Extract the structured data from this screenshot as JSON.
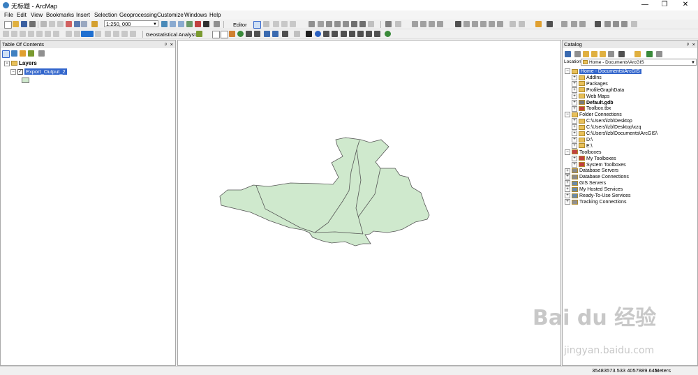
{
  "window": {
    "title": "无标题 - ArcMap",
    "minimize": "—",
    "maximize": "❐",
    "close": "✕"
  },
  "menu": [
    "File",
    "Edit",
    "View",
    "Bookmarks",
    "Insert",
    "Selection",
    "Geoprocessing",
    "Customize",
    "Windows",
    "Help"
  ],
  "toolbar": {
    "scale": "1:250, 000",
    "editor_label": "Editor",
    "geostat_label": "Geostatistical Analyst"
  },
  "toc": {
    "title": "Table Of Contents",
    "root": "Layers",
    "layer": "Export_Output_2"
  },
  "catalog": {
    "title": "Catalog",
    "location_label": "Location:",
    "location_value": "Home - Documents\\ArcGIS",
    "items": [
      {
        "label": "Home - Documents\\ArcGIS",
        "level": 0,
        "icon": "folder-icon",
        "selected": true
      },
      {
        "label": "AddIns",
        "level": 1,
        "icon": "folder-icon"
      },
      {
        "label": "Packages",
        "level": 1,
        "icon": "folder-icon"
      },
      {
        "label": "ProfileGraphData",
        "level": 1,
        "icon": "folder-icon"
      },
      {
        "label": "Web Maps",
        "level": 1,
        "icon": "folder-icon"
      },
      {
        "label": "Default.gdb",
        "level": 1,
        "icon": "geodatabase-icon",
        "bold": true
      },
      {
        "label": "Toolbox.tbx",
        "level": 1,
        "icon": "toolbox-icon"
      },
      {
        "label": "Folder Connections",
        "level": 0,
        "icon": "folder-connections-icon"
      },
      {
        "label": "C:\\Users\\lzb\\Desktop",
        "level": 1,
        "icon": "folder-icon"
      },
      {
        "label": "C:\\Users\\lzb\\Desktop\\xzq",
        "level": 1,
        "icon": "folder-icon"
      },
      {
        "label": "C:\\Users\\lzb\\Documents\\ArcGIS\\",
        "level": 1,
        "icon": "folder-icon"
      },
      {
        "label": "D:\\",
        "level": 1,
        "icon": "folder-icon"
      },
      {
        "label": "E:\\",
        "level": 1,
        "icon": "folder-icon"
      },
      {
        "label": "Toolboxes",
        "level": 0,
        "icon": "toolboxes-icon"
      },
      {
        "label": "My Toolboxes",
        "level": 1,
        "icon": "toolbox-icon"
      },
      {
        "label": "System Toolboxes",
        "level": 1,
        "icon": "toolbox-icon"
      },
      {
        "label": "Database Servers",
        "level": 0,
        "icon": "database-server-icon"
      },
      {
        "label": "Database Connections",
        "level": 0,
        "icon": "database-connection-icon"
      },
      {
        "label": "GIS Servers",
        "level": 0,
        "icon": "gis-server-icon"
      },
      {
        "label": "My Hosted Services",
        "level": 0,
        "icon": "hosted-services-icon"
      },
      {
        "label": "Ready-To-Use Services",
        "level": 0,
        "icon": "ready-services-icon"
      },
      {
        "label": "Tracking Connections",
        "level": 0,
        "icon": "tracking-icon"
      }
    ]
  },
  "status": {
    "coords": "35483573.533  4057889.645",
    "units": "Meters"
  },
  "watermark": {
    "logo": "Bai du 经验",
    "url": "jingyan.baidu.com"
  },
  "colors": {
    "polygon_fill": "#cfe9cd",
    "polygon_stroke": "#555555",
    "selection": "#3366cc"
  }
}
